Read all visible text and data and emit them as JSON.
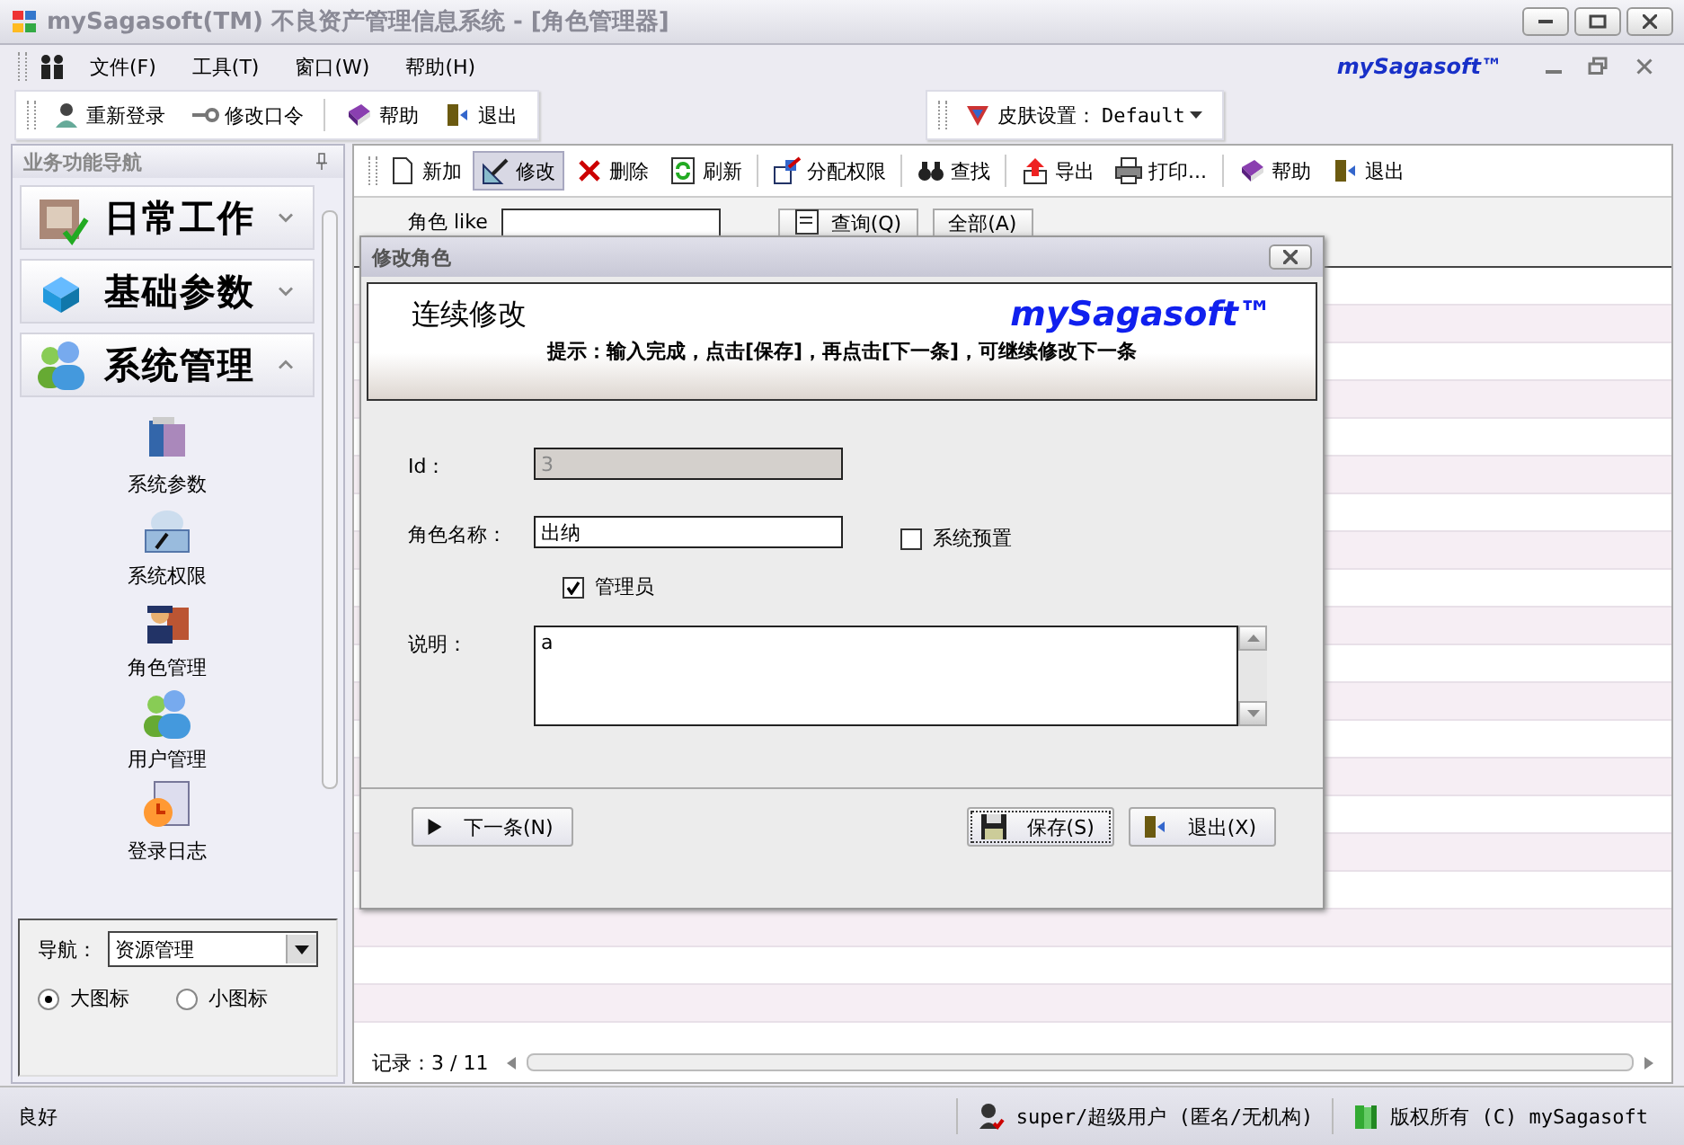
{
  "window": {
    "title": "mySagasoft(TM) 不良资产管理信息系统 - [角色管理器]"
  },
  "menu": [
    "文件(F)",
    "工具(T)",
    "窗口(W)",
    "帮助(H)"
  ],
  "brand": "mySagasoft™",
  "toolbar": [
    "重新登录",
    "修改口令",
    "帮助",
    "退出"
  ],
  "skin": {
    "label": "皮肤设置：",
    "value": "Default"
  },
  "sidebar": {
    "title": "业务功能导航",
    "groups": [
      {
        "label": "日常工作",
        "expanded": false
      },
      {
        "label": "基础参数",
        "expanded": false
      },
      {
        "label": "系统管理",
        "expanded": true,
        "items": [
          "系统参数",
          "系统权限",
          "角色管理",
          "用户管理",
          "登录日志"
        ]
      }
    ],
    "nav_label": "导航：",
    "nav_value": "资源管理",
    "views": [
      {
        "label": "大图标",
        "selected": true
      },
      {
        "label": "小图标",
        "selected": false
      }
    ]
  },
  "content": {
    "toolbar": [
      {
        "label": "新加",
        "pressed": false
      },
      {
        "label": "修改",
        "pressed": true
      },
      {
        "label": "删除",
        "pressed": false
      },
      {
        "label": "刷新",
        "pressed": false
      },
      {
        "label": "分配权限",
        "pressed": false
      },
      {
        "label": "查找",
        "pressed": false
      },
      {
        "label": "导出",
        "pressed": false
      },
      {
        "label": "打印...",
        "pressed": false
      },
      {
        "label": "帮助",
        "pressed": false
      },
      {
        "label": "退出",
        "pressed": false
      }
    ],
    "search": {
      "label": "角色 like",
      "buttons": [
        "查询(Q)",
        "全部(A)"
      ]
    },
    "record": "记录：3 / 11"
  },
  "dialog": {
    "title": "修改角色",
    "banner_title": "连续修改",
    "banner_brand": "mySagasoft™",
    "hint": "提示：输入完成，点击[保存]，再点击[下一条]，可继续修改下一条",
    "id_label": "Id：",
    "id_value": "3",
    "name_label": "角色名称：",
    "name_value": "出纳",
    "preset": {
      "label": "系统预置",
      "checked": false
    },
    "admin": {
      "label": "管理员",
      "checked": true
    },
    "desc_label": "说明：",
    "desc_value": "a",
    "buttons": [
      {
        "label": "下一条(N)",
        "focused": false
      },
      {
        "label": "保存(S)",
        "focused": true
      },
      {
        "label": "退出(X)",
        "focused": false
      }
    ]
  },
  "status_bar": [
    "良好",
    "super/超级用户 (匿名/无机构)",
    "版权所有 (C) mySagasoft"
  ]
}
